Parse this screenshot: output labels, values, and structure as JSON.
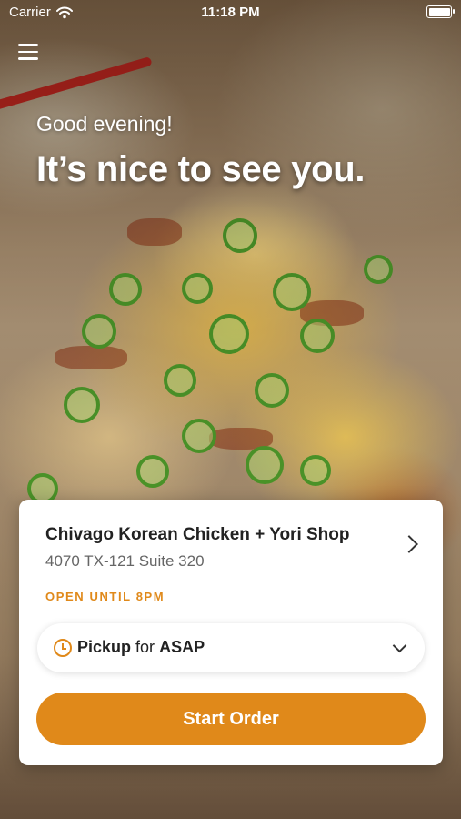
{
  "status_bar": {
    "carrier": "Carrier",
    "time": "11:18 PM",
    "wifi_icon": "wifi-icon",
    "battery_icon": "battery-icon"
  },
  "header": {
    "menu_icon": "hamburger-menu-icon"
  },
  "hero": {
    "greeting": "Good evening!",
    "headline": "It’s nice to see you."
  },
  "location_card": {
    "name": "Chivago Korean Chicken + Yori Shop",
    "address": "4070 TX-121 Suite 320",
    "hours": "OPEN UNTIL 8PM",
    "order_mode": {
      "method": "Pickup",
      "connector": "for",
      "time": "ASAP"
    },
    "start_order_label": "Start Order"
  },
  "colors": {
    "accent": "#e0891a",
    "card_bg": "#ffffff",
    "text_dark": "#222222",
    "text_muted": "#666666"
  }
}
